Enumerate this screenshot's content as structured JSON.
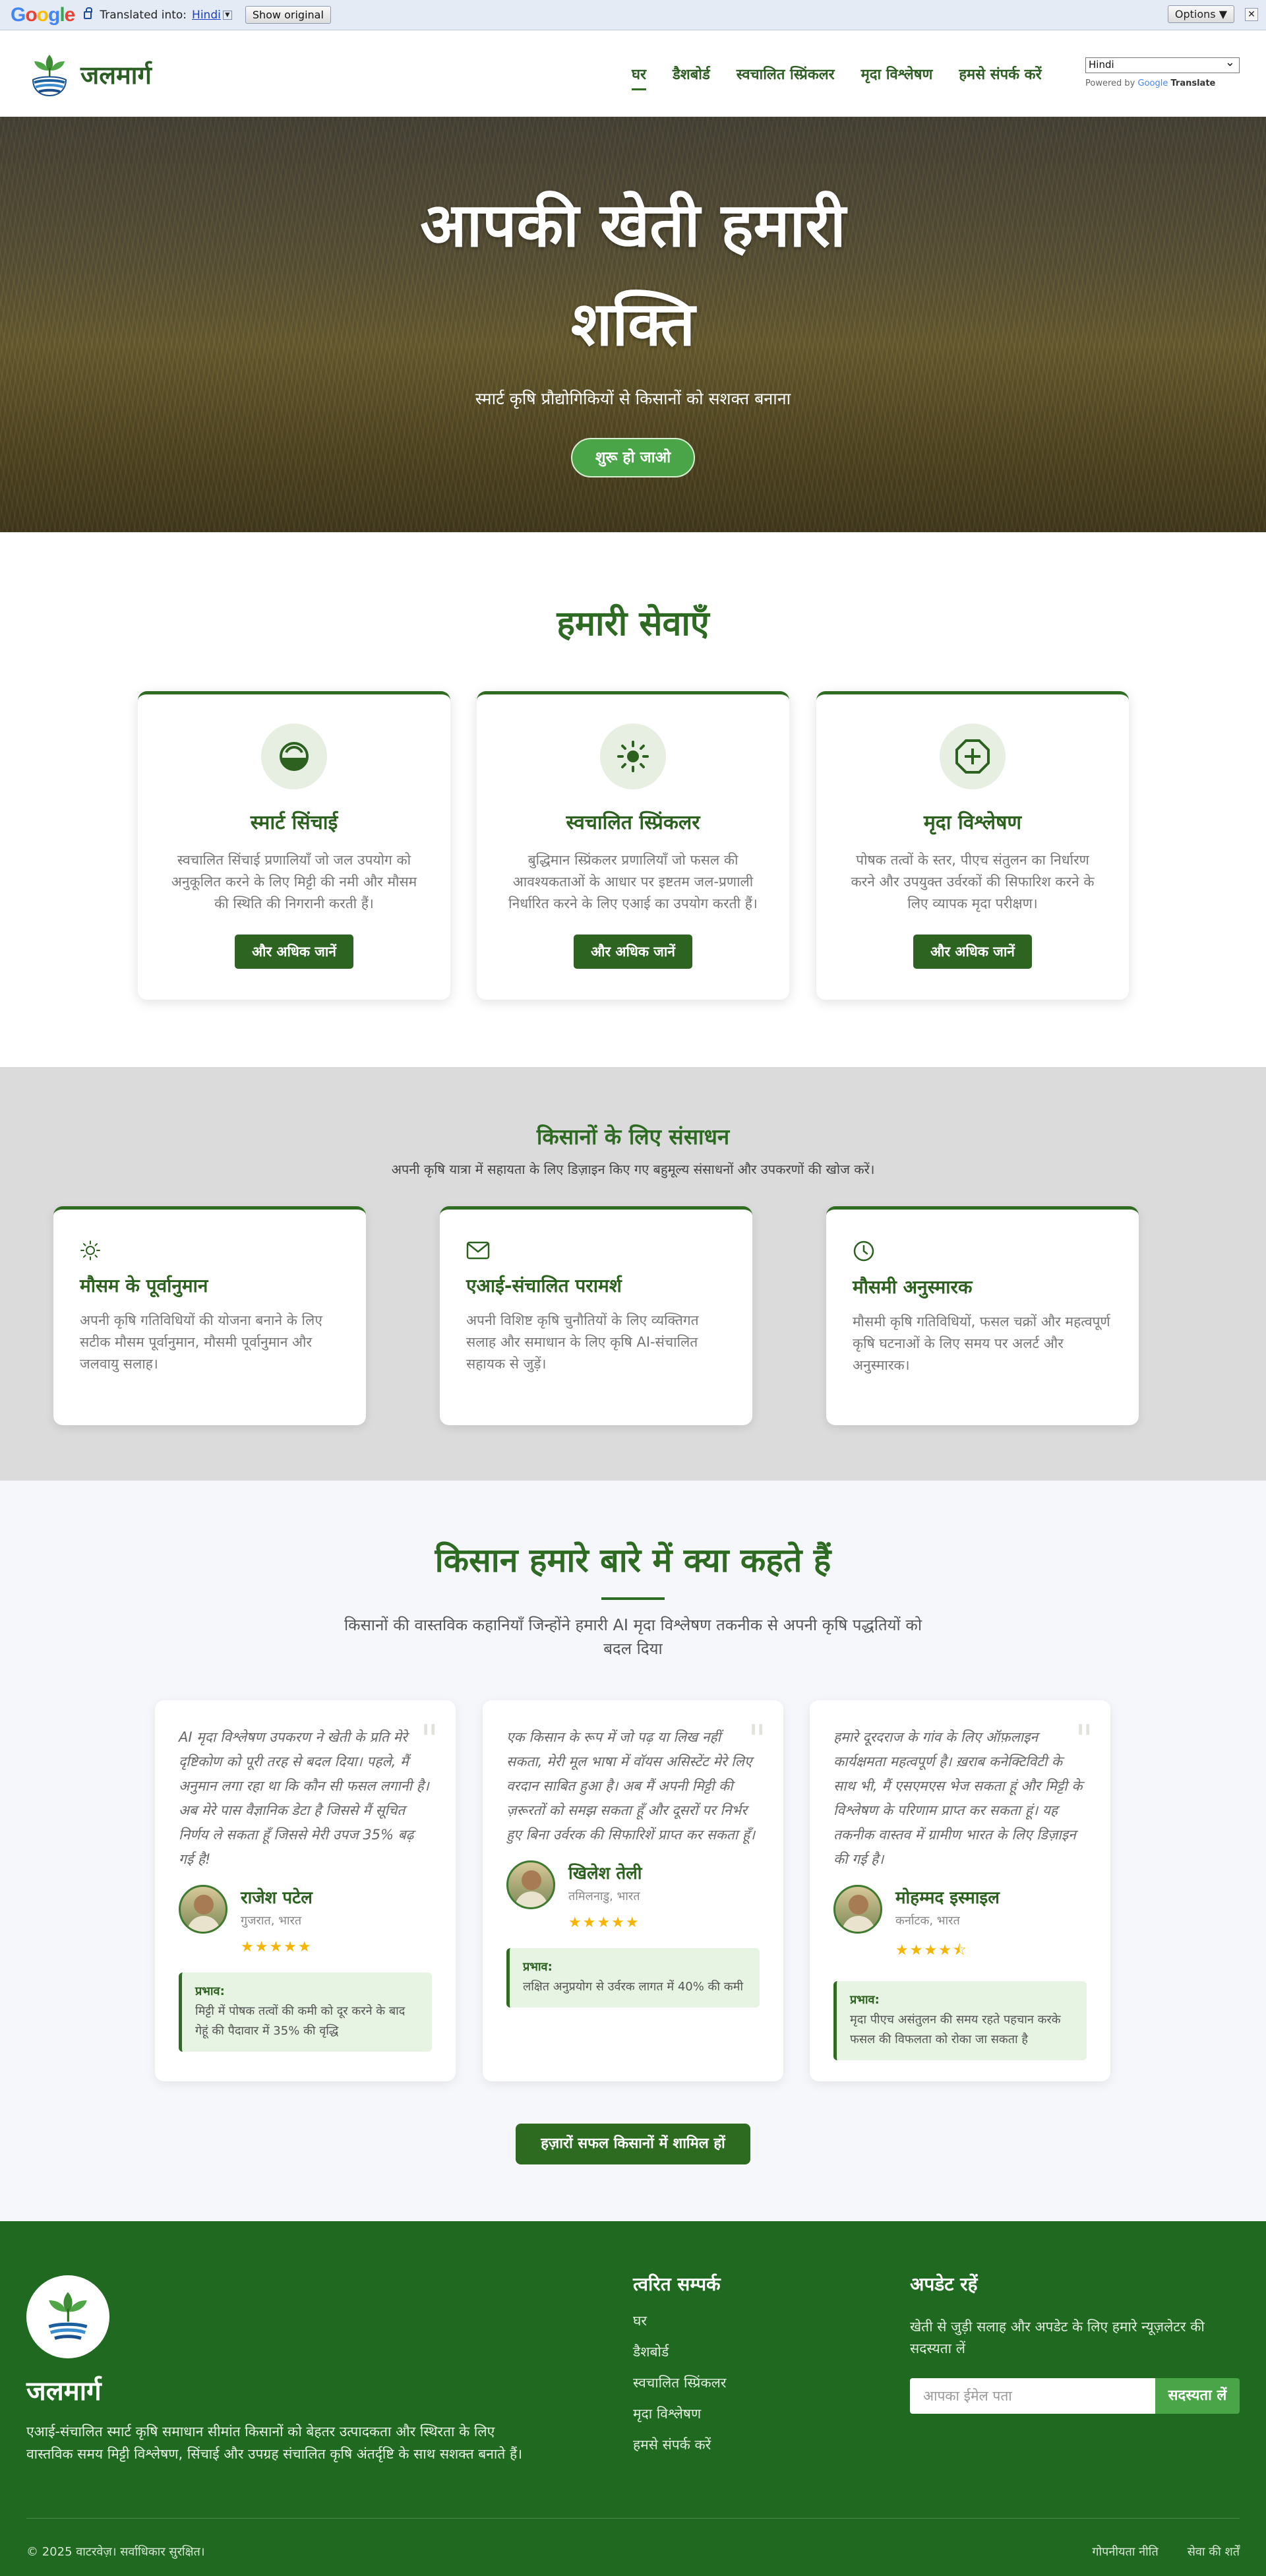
{
  "translate_bar": {
    "logo": [
      "G",
      "o",
      "o",
      "g",
      "l",
      "e"
    ],
    "translated_into": "Translated into:",
    "language": "Hindi",
    "show_original": "Show original",
    "options": "Options ▼",
    "close": "✕"
  },
  "header": {
    "brand": "जलमार्ग",
    "nav": [
      "घर",
      "डैशबोर्ड",
      "स्वचालित स्प्रिंकलर",
      "मृदा विश्लेषण",
      "हमसे संपर्क करें"
    ],
    "language_select": "Hindi",
    "powered_by": "Powered by",
    "google": "Google",
    "translate": "Translate"
  },
  "hero": {
    "title_line1": "आपकी खेती हमारी",
    "title_line2": "शक्ति",
    "subtitle": "स्मार्ट कृषि प्रौद्योगिकियों से किसानों को सशक्त बनाना",
    "button": "शुरू हो जाओ"
  },
  "services": {
    "title": "हमारी सेवाएँ",
    "items": [
      {
        "icon": "drop-half-icon",
        "title": "स्मार्ट सिंचाई",
        "text": "स्वचालित सिंचाई प्रणालियाँ जो जल उपयोग को अनुकूलित करने के लिए मिट्टी की नमी और मौसम की स्थिति की निगरानी करती हैं।",
        "button": "और अधिक जानें"
      },
      {
        "icon": "sun-icon",
        "title": "स्वचालित स्प्रिंकलर",
        "text": "बुद्धिमान स्प्रिंकलर प्रणालियाँ जो फसल की आवश्यकताओं के आधार पर इष्टतम जल-प्रणाली निर्धारित करने के लिए एआई का उपयोग करती हैं।",
        "button": "और अधिक जानें"
      },
      {
        "icon": "plus-octagon-icon",
        "title": "मृदा विश्लेषण",
        "text": "पोषक तत्वों के स्तर, पीएच संतुलन का निर्धारण करने और उपयुक्त उर्वरकों की सिफारिश करने के लिए व्यापक मृदा परीक्षण।",
        "button": "और अधिक जानें"
      }
    ]
  },
  "resources": {
    "title": "किसानों के लिए संसाधन",
    "subtitle": "अपनी कृषि यात्रा में सहायता के लिए डिज़ाइन किए गए बहुमूल्य संसाधनों और उपकरणों की खोज करें।",
    "items": [
      {
        "icon": "sun-icon",
        "title": "मौसम के पूर्वानुमान",
        "text": "अपनी कृषि गतिविधियों की योजना बनाने के लिए सटीक मौसम पूर्वानुमान, मौसमी पूर्वानुमान और जलवायु सलाह।"
      },
      {
        "icon": "mail-icon",
        "title": "एआई-संचालित परामर्श",
        "text": "अपनी विशिष्ट कृषि चुनौतियों के लिए व्यक्तिगत सलाह और समाधान के लिए कृषि AI-संचालित सहायक से जुड़ें।"
      },
      {
        "icon": "clock-icon",
        "title": "मौसमी अनुस्मारक",
        "text": "मौसमी कृषि गतिविधियों, फसल चक्रों और महत्वपूर्ण कृषि घटनाओं के लिए समय पर अलर्ट और अनुस्मारक।"
      }
    ]
  },
  "testimonials": {
    "title": "किसान हमारे बारे में क्या कहते हैं",
    "subtitle_line1": "किसानों की वास्तविक कहानियाँ जिन्होंने हमारी AI मृदा विश्लेषण तकनीक से अपनी कृषि पद्धतियों को",
    "subtitle_line2": "बदल दिया",
    "items": [
      {
        "quote": "AI मृदा विश्लेषण उपकरण ने खेती के प्रति मेरे दृष्टिकोण को पूरी तरह से बदल दिया। पहले, मैं अनुमान लगा रहा था कि कौन सी फसल लगानी है। अब मेरे पास वैज्ञानिक डेटा है जिससे मैं सूचित निर्णय ले सकता हूँ जिससे मेरी उपज 35% बढ़ गई है!",
        "name": "राजेश पटेल",
        "location": "गुजरात, भारत",
        "stars": "★★★★★",
        "impact_label": "प्रभाव:",
        "impact": "मिट्टी में पोषक तत्वों की कमी को दूर करने के बाद गेहूं की पैदावार में 35% की वृद्धि"
      },
      {
        "quote": "एक किसान के रूप में जो पढ़ या लिख नहीं सकता, मेरी मूल भाषा में वॉयस असिस्टेंट मेरे लिए वरदान साबित हुआ है। अब मैं अपनी मिट्टी की ज़रूरतों को समझ सकता हूँ और दूसरों पर निर्भर हुए बिना उर्वरक की सिफारिशें प्राप्त कर सकता हूँ।",
        "name": "खिलेश तेली",
        "location": "तमिलनाडु, भारत",
        "stars": "★★★★★",
        "impact_label": "प्रभाव:",
        "impact": "लक्षित अनुप्रयोग से उर्वरक लागत में 40% की कमी"
      },
      {
        "quote": "हमारे दूरदराज के गांव के लिए ऑफ़लाइन कार्यक्षमता महत्वपूर्ण है। ख़राब कनेक्टिविटी के साथ भी, मैं एसएमएस भेज सकता हूं और मिट्टी के विश्लेषण के परिणाम प्राप्त कर सकता हूं। यह तकनीक वास्तव में ग्रामीण भारत के लिए डिज़ाइन की गई है।",
        "name": "मोहम्मद इस्माइल",
        "location": "कर्नाटक, भारत",
        "stars": "★★★★⯪",
        "impact_label": "प्रभाव:",
        "impact": "मृदा पीएच असंतुलन की समय रहते पहचान करके फसल की विफलता को रोका जा सकता है"
      }
    ],
    "cta": "हज़ारों सफल किसानों में शामिल हों"
  },
  "footer": {
    "brand": "जलमार्ग",
    "description": "एआई-संचालित स्मार्ट कृषि समाधान सीमांत किसानों को बेहतर उत्पादकता और स्थिरता के लिए वास्तविक समय मिट्टी विश्लेषण, सिंचाई और उपग्रह संचालित कृषि अंतर्दृष्टि के साथ सशक्त बनाते हैं।",
    "quick_links_title": "त्वरित सम्पर्क",
    "quick_links": [
      "घर",
      "डैशबोर्ड",
      "स्वचालित स्प्रिंकलर",
      "मृदा विश्लेषण",
      "हमसे संपर्क करें"
    ],
    "updates_title": "अपडेट रहें",
    "updates_text": "खेती से जुड़ी सलाह और अपडेट के लिए हमारे न्यूज़लेटर की सदस्यता लें",
    "email_placeholder": "आपका ईमेल पता",
    "subscribe": "सदस्यता लें",
    "copyright": "© 2025 वाटरवेज़। सर्वाधिकार सुरक्षित।",
    "privacy": "गोपनीयता नीति",
    "terms": "सेवा की शर्तें"
  },
  "colors": {
    "brand_green": "#2d6421",
    "accent_green": "#4aa548",
    "card_border": "#2f6b21"
  }
}
